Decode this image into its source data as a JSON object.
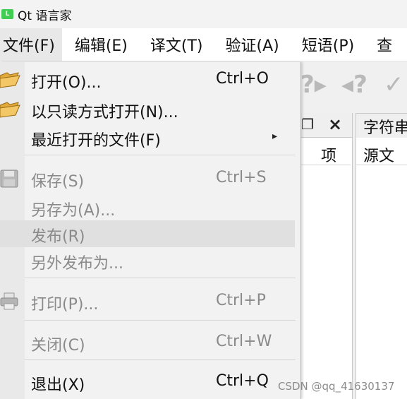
{
  "window": {
    "title": "Qt 语言家",
    "app_icon": "L"
  },
  "menubar": [
    {
      "label": "文件(F)",
      "active": true
    },
    {
      "label": "编辑(E)"
    },
    {
      "label": "译文(T)"
    },
    {
      "label": "验证(A)"
    },
    {
      "label": "短语(P)"
    },
    {
      "label": "查"
    }
  ],
  "file_menu": {
    "open": {
      "label": "打开(O)...",
      "shortcut": "Ctrl+O"
    },
    "open_readonly": {
      "label": "以只读方式打开(N)..."
    },
    "recent": {
      "label": "最近打开的文件(F)",
      "arrow": "▸"
    },
    "save": {
      "label": "保存(S)",
      "shortcut": "Ctrl+S"
    },
    "save_as": {
      "label": "另存为(A)..."
    },
    "release": {
      "label": "发布(R)"
    },
    "release_as": {
      "label": "另外发布为..."
    },
    "print": {
      "label": "打印(P)...",
      "shortcut": "Ctrl+P"
    },
    "close": {
      "label": "关闭(C)",
      "shortcut": "Ctrl+W"
    },
    "exit": {
      "label": "退出(X)",
      "shortcut": "Ctrl+Q"
    }
  },
  "dock_left": {
    "column_header": "项"
  },
  "dock_right": {
    "title": "字符串",
    "column_header": "源文"
  },
  "watermark": "CSDN @qq_41630137",
  "colors": {
    "app_icon": "#41cd52",
    "menu_bg": "#f2f2f2",
    "disabled_text": "#8a8a8a"
  }
}
